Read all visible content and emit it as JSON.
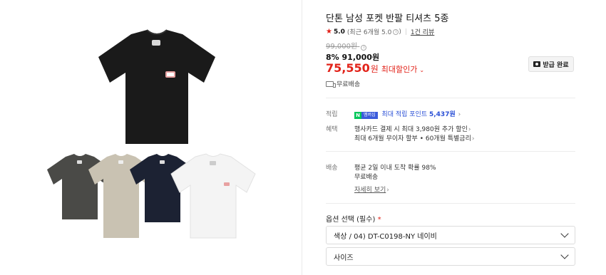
{
  "product": {
    "title": "단톤 남성 포켓 반팔 티셔츠 5종",
    "rating": {
      "score": "5.0",
      "detail": "(최근 6개월 5.0",
      "detail_close": ")",
      "review_link": "1건 리뷰"
    },
    "original_price": "99,000원",
    "discount_line": "8% 91,000원",
    "final_price": "75,550",
    "final_unit": "원",
    "max_discount_label": "최대할인가",
    "coupon_button": "받급 완료",
    "shipping": "무료배송"
  },
  "benefits": {
    "points_label": "적립",
    "points_badge_n": "N",
    "points_badge_m": "멤버십",
    "points_text": "최대 적립 포인트 ",
    "points_value": "5,437원",
    "card_label": "혜택",
    "card_line1": "행사카드 결제 시 최대 3,980원 추가 할인",
    "card_line2": "최대 6개월 무이자 할부 • 60개월 특별금리"
  },
  "delivery": {
    "label": "배송",
    "line1": "평균 2일 이내 도착 확률 98%",
    "line2": "무료배송",
    "more_link": "자세히 보기"
  },
  "options": {
    "label": "옵션 선택 (필수)",
    "required_mark": "*",
    "color_select": "색상 / 04) DT-C0198-NY 네이비",
    "size_select": "사이즈"
  },
  "gallery": {
    "colors": {
      "black": "#1a1a1a",
      "charcoal": "#4a4a47",
      "beige": "#c9c2b2",
      "navy": "#1c2233",
      "white": "#f4f4f4"
    }
  },
  "accent_color": "#e2231a"
}
